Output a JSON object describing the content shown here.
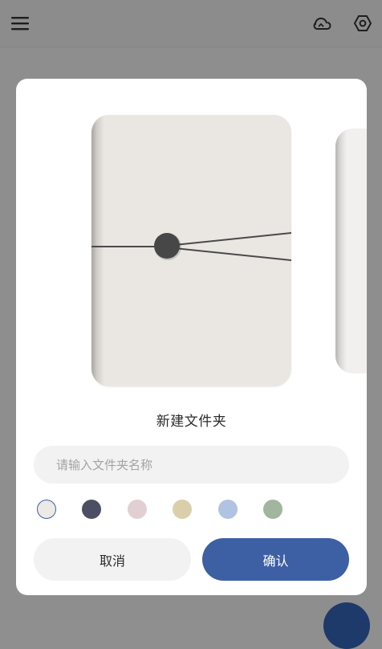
{
  "topbar": {
    "menu_icon": "hamburger-menu-icon",
    "cloud_sync_icon": "cloud-sync-icon",
    "settings_icon": "hex-settings-icon"
  },
  "dialog": {
    "title": "新建文件夹",
    "name_input": {
      "placeholder": "请输入文件夹名称",
      "value": ""
    },
    "colors": [
      {
        "name": "beige",
        "hex": "#ede9e4",
        "selected": true
      },
      {
        "name": "slate",
        "hex": "#4c4f63",
        "selected": false
      },
      {
        "name": "pink",
        "hex": "#e2cfd3",
        "selected": false
      },
      {
        "name": "sand",
        "hex": "#dbcfab",
        "selected": false
      },
      {
        "name": "blue",
        "hex": "#b1c3e3",
        "selected": false
      },
      {
        "name": "sage",
        "hex": "#a1b59f",
        "selected": false
      }
    ],
    "cancel_label": "取消",
    "confirm_label": "确认"
  },
  "theme": {
    "accent": "#3d5fa3",
    "overlay": "#8e8e8e"
  }
}
